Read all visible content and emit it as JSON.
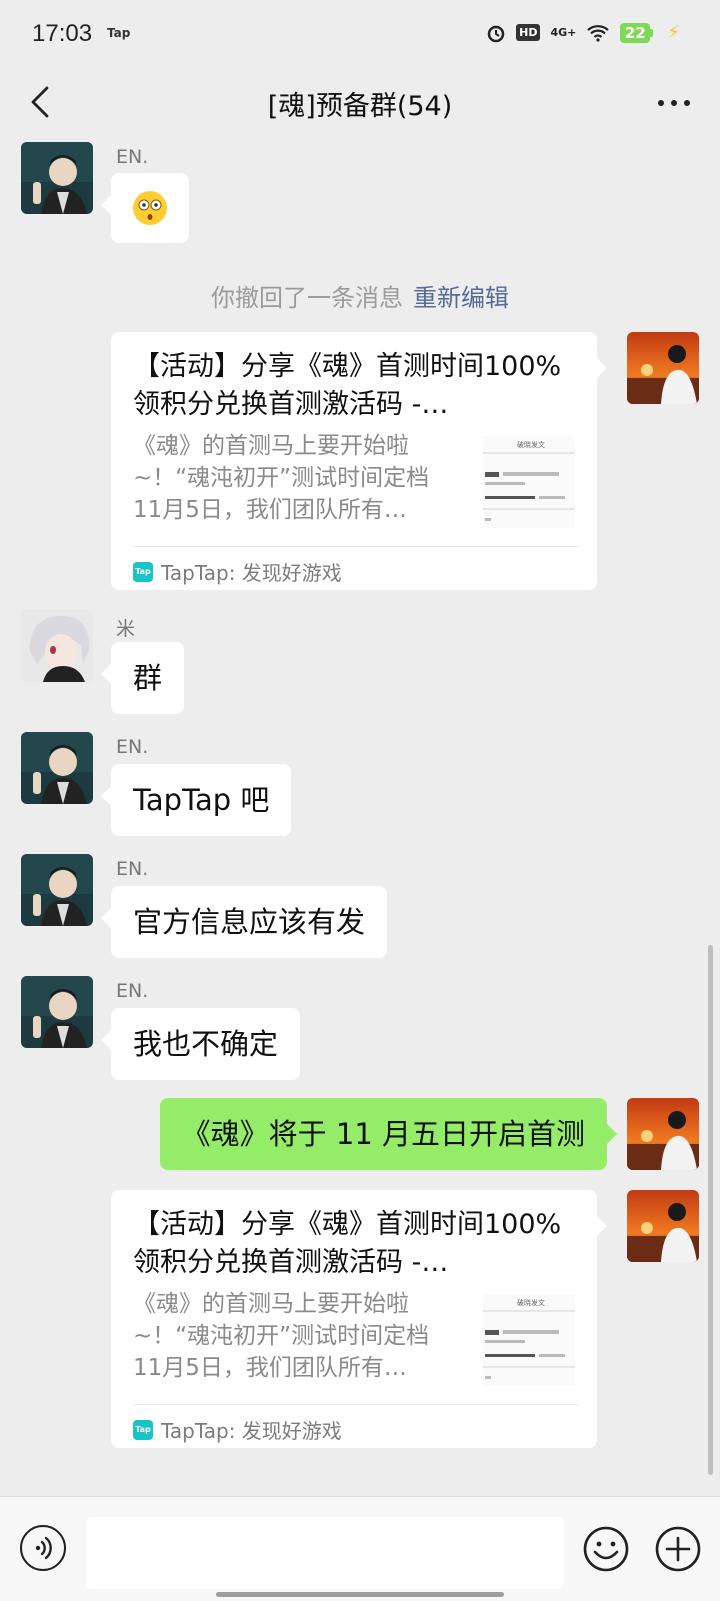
{
  "status_bar": {
    "time": "17:03",
    "tap_badge": "Tap",
    "hd": "HD",
    "network": "4G+",
    "battery": "22"
  },
  "header": {
    "title": "[魂]预备群(54)"
  },
  "messages": {
    "m1": {
      "sender": "EN.",
      "content_icon": "astonished-emoji"
    },
    "recall": {
      "text": "你撤回了一条消息",
      "action": "重新编辑"
    },
    "card1": {
      "title": "【活动】分享《魂》首测时间100%领积分兑换首测激活码 -…",
      "desc": "《魂》的首测马上要开始啦~！“魂沌初开”测试时间定档11月5日，我们团队所有…",
      "source": "TapTap: 发现好游戏"
    },
    "m2": {
      "sender": "米",
      "text": "群"
    },
    "m3": {
      "sender": "EN.",
      "text": "TapTap 吧"
    },
    "m4": {
      "sender": "EN.",
      "text": "官方信息应该有发"
    },
    "m5": {
      "sender": "EN.",
      "text": "我也不确定"
    },
    "m6": {
      "text": "《魂》将于 11 月五日开启首测"
    },
    "card2": {
      "title": "【活动】分享《魂》首测时间100%领积分兑换首测激活码 -…",
      "desc": "《魂》的首测马上要开始啦~！“魂沌初开”测试时间定档11月5日，我们团队所有…",
      "source": "TapTap: 发现好游戏"
    }
  },
  "input_bar": {
    "placeholder": ""
  },
  "colors": {
    "background": "#ededed",
    "my_bubble": "#95ec69",
    "link": "#576b95"
  }
}
